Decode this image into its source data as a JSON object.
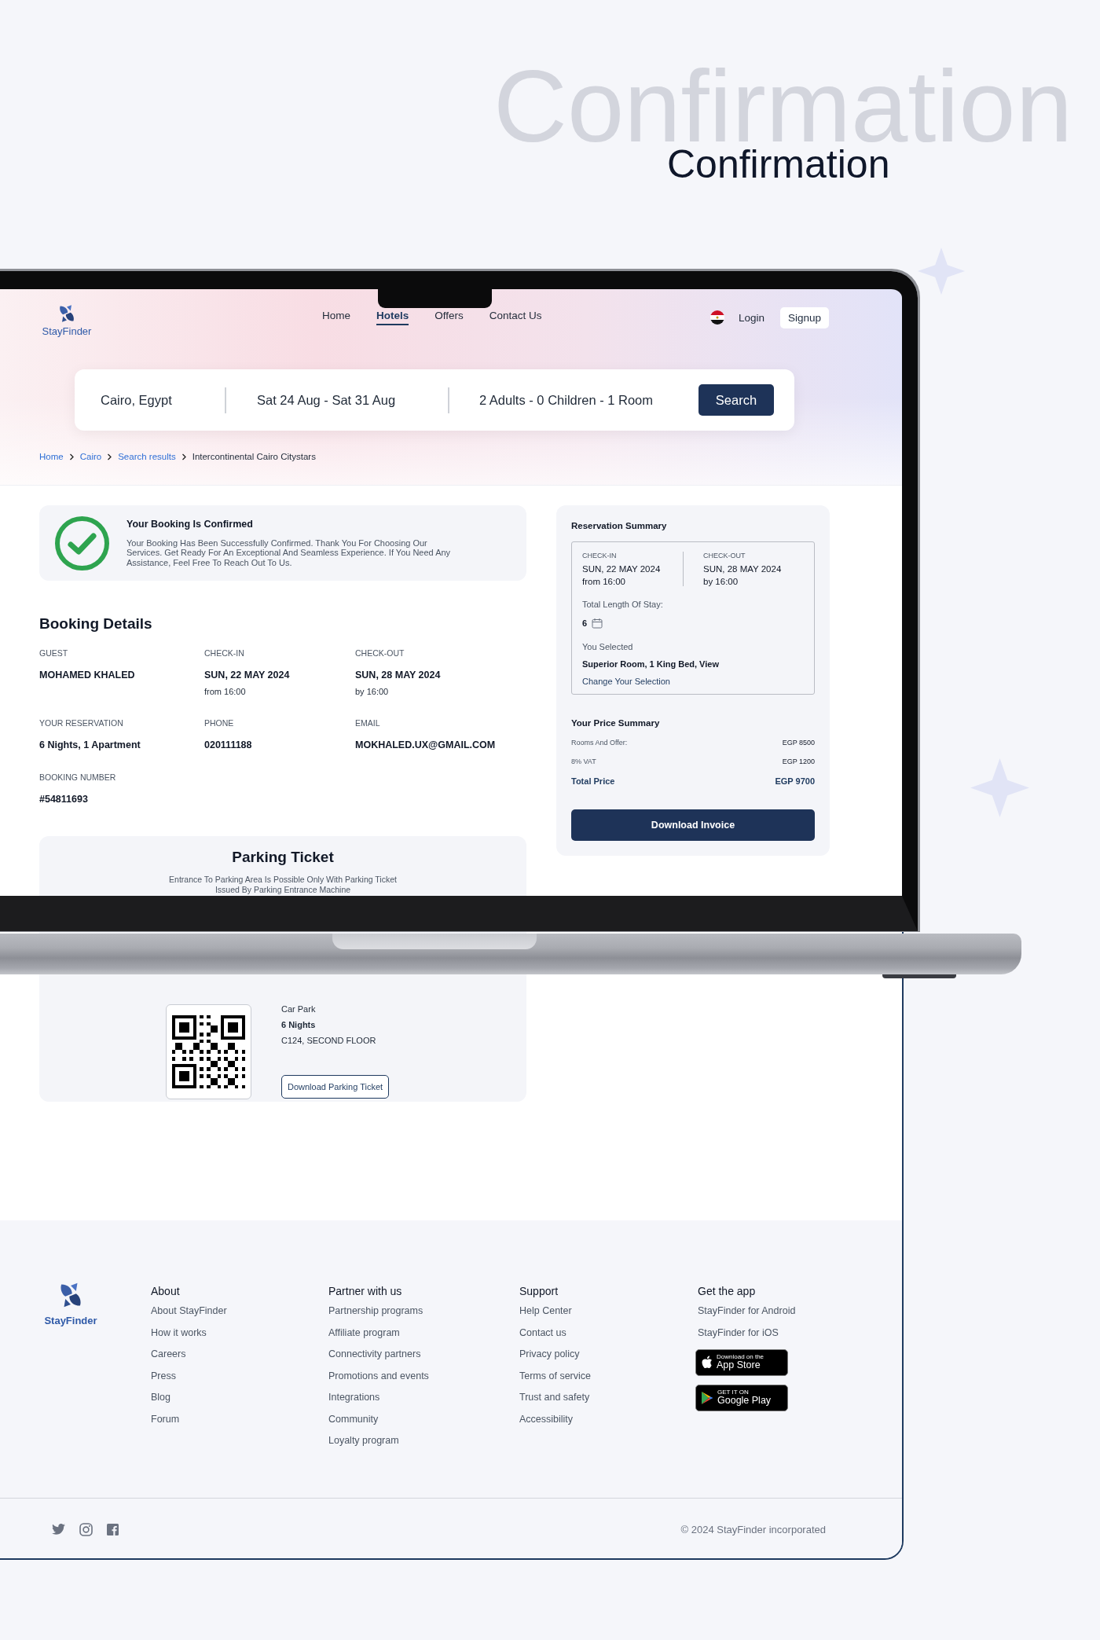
{
  "heading": {
    "backdrop": "Confirmation",
    "title": "Confirmation"
  },
  "site": {
    "brand": "StayFinder",
    "nav": [
      {
        "label": "Home",
        "selected": false
      },
      {
        "label": "Hotels",
        "selected": true
      },
      {
        "label": "Offers",
        "selected": false
      },
      {
        "label": "Contact Us",
        "selected": false
      }
    ],
    "login": "Login",
    "signup": "Signup"
  },
  "search": {
    "location": "Cairo, Egypt",
    "dates": "Sat 24 Aug - Sat 31 Aug",
    "guests": "2 Adults - 0 Children - 1 Room",
    "button": "Search"
  },
  "breadcrumb": [
    {
      "label": "Home",
      "current": false
    },
    {
      "label": "Cairo",
      "current": false
    },
    {
      "label": "Search results",
      "current": false
    },
    {
      "label": "Intercontinental Cairo Citystars",
      "current": true
    }
  ],
  "confirmation": {
    "title": "Your Booking Is Confirmed",
    "message": "Your Booking Has Been Successfully Confirmed. Thank You For Choosing Our Services. Get Ready For An Exceptional And Seamless Experience. If You Need Any Assistance, Feel Free To Reach Out To Us."
  },
  "booking_details": {
    "title": "Booking Details",
    "fields": [
      {
        "label": "GUEST",
        "value": "MOHAMED KHALED"
      },
      {
        "label": "CHECK-IN",
        "value": "SUN, 22 MAY 2024",
        "note": "from 16:00"
      },
      {
        "label": "CHECK-OUT",
        "value": "SUN, 28 MAY 2024",
        "note": "by 16:00"
      },
      {
        "label": "YOUR RESERVATION",
        "value": "6 Nights, 1 Apartment"
      },
      {
        "label": "PHONE",
        "value": "020111188"
      },
      {
        "label": "EMAIL",
        "value": "MOKHALED.UX@GMAIL.COM"
      },
      {
        "label": "BOOKING NUMBER",
        "value": "#54811693"
      }
    ]
  },
  "parking": {
    "title": "Parking Ticket",
    "description": [
      "Entrance To Parking  Area Is Possible Only With Parking Ticket",
      "Issued By Parking Entrance Machine"
    ],
    "details": [
      {
        "text": "Car Park",
        "bold": false
      },
      {
        "text": "6 Nights",
        "bold": true
      },
      {
        "text": "C124, SECOND FLOOR",
        "bold": false
      }
    ],
    "button": "Download Parking Ticket"
  },
  "summary": {
    "title": "Reservation Summary",
    "check_in": {
      "label": "CHECK-IN",
      "date": "SUN, 22 MAY 2024",
      "time": "from 16:00"
    },
    "check_out": {
      "label": "CHECK-OUT",
      "date": "SUN, 28 MAY 2024",
      "time": "by 16:00"
    },
    "stay_label": "Total Length Of Stay:",
    "stay_value": "6",
    "selected_label": "You Selected",
    "selected_room": "Superior Room, 1 King Bed, View",
    "change_link": "Change Your Selection",
    "price_title": "Your Price Summary",
    "prices": [
      {
        "label": "Rooms And Offer:",
        "amount": "EGP 8500",
        "total": false
      },
      {
        "label": "8% VAT",
        "amount": "EGP 1200",
        "total": false
      },
      {
        "label": "Total Price",
        "amount": "EGP 9700",
        "total": true
      }
    ],
    "button": "Download Invoice"
  },
  "footer": {
    "brand": "StayFinder",
    "columns": [
      {
        "title": "About",
        "links": [
          "About StayFinder",
          "How it works",
          "Careers",
          "Press",
          "Blog",
          "Forum"
        ]
      },
      {
        "title": "Partner with us",
        "links": [
          "Partnership programs",
          "Affiliate program",
          "Connectivity partners",
          "Promotions and events",
          "Integrations",
          "Community",
          "Loyalty program"
        ]
      },
      {
        "title": "Support",
        "links": [
          "Help Center",
          "Contact us",
          "Privacy policy",
          "Terms of service",
          "Trust and safety",
          "Accessibility"
        ]
      },
      {
        "title": "Get the app",
        "links": [
          "StayFinder for Android",
          "StayFinder for iOS"
        ]
      }
    ],
    "apps": [
      {
        "kind": "app_store",
        "small": "Download on the",
        "big": "App Store"
      },
      {
        "kind": "google_play",
        "small": "GET IT ON",
        "big": "Google Play"
      }
    ],
    "copyright": "© 2024 StayFinder incorporated"
  }
}
